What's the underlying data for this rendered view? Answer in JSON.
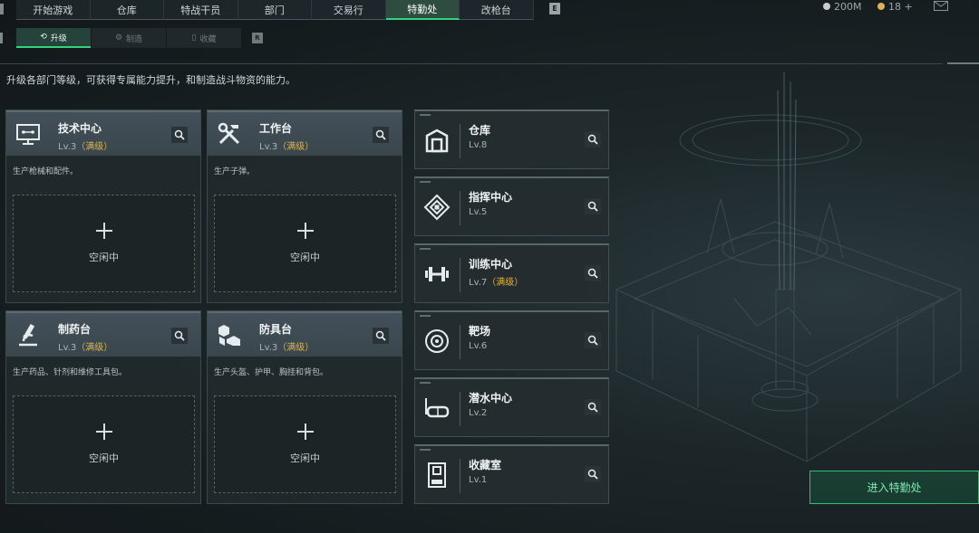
{
  "nav": {
    "tabs": [
      "开始游戏",
      "仓库",
      "特战干员",
      "部门",
      "交易行",
      "特勤处",
      "改枪台"
    ],
    "active": 5,
    "key_hint": "E"
  },
  "currency": [
    {
      "value": "200M",
      "color": "#c8ccce"
    },
    {
      "value": "18 +",
      "color": "#d7b35a"
    }
  ],
  "subnav": {
    "tabs": [
      {
        "label": "升级",
        "icon": "upgrade-icon"
      },
      {
        "label": "制造",
        "icon": "craft-icon"
      },
      {
        "label": "收藏",
        "icon": "collection-icon"
      }
    ],
    "active": 0,
    "key_hint": "R"
  },
  "page": {
    "description": "升级各部门等级，可获得专属能力提升，和制造战斗物资的能力。",
    "enter_button": "进入特勤处"
  },
  "big_cards": [
    {
      "name": "技术中心",
      "level": "Lv.3",
      "max_tag": "（满级）",
      "desc": "生产枪械和配件。",
      "slot": "空闲中",
      "icon": "tech-center-icon"
    },
    {
      "name": "工作台",
      "level": "Lv.3",
      "max_tag": "（满级）",
      "desc": "生产子弹。",
      "slot": "空闲中",
      "icon": "workbench-icon"
    },
    {
      "name": "制药台",
      "level": "Lv.3",
      "max_tag": "（满级）",
      "desc": "生产药品、针剂和维修工具包。",
      "slot": "空闲中",
      "icon": "pharmacy-icon"
    },
    {
      "name": "防具台",
      "level": "Lv.3",
      "max_tag": "（满级）",
      "desc": "生产头盔、护甲、胸挂和背包。",
      "slot": "空闲中",
      "icon": "armor-bench-icon"
    }
  ],
  "side_cards": [
    {
      "name": "仓库",
      "level": "Lv.8",
      "max_tag": "",
      "icon": "warehouse-icon"
    },
    {
      "name": "指挥中心",
      "level": "Lv.5",
      "max_tag": "",
      "icon": "command-center-icon"
    },
    {
      "name": "训练中心",
      "level": "Lv.7",
      "max_tag": "（满级）",
      "icon": "training-center-icon"
    },
    {
      "name": "靶场",
      "level": "Lv.6",
      "max_tag": "",
      "icon": "shooting-range-icon"
    },
    {
      "name": "潜水中心",
      "level": "Lv.2",
      "max_tag": "",
      "icon": "diving-center-icon"
    },
    {
      "name": "收藏室",
      "level": "Lv.1",
      "max_tag": "",
      "icon": "collection-room-icon"
    }
  ]
}
